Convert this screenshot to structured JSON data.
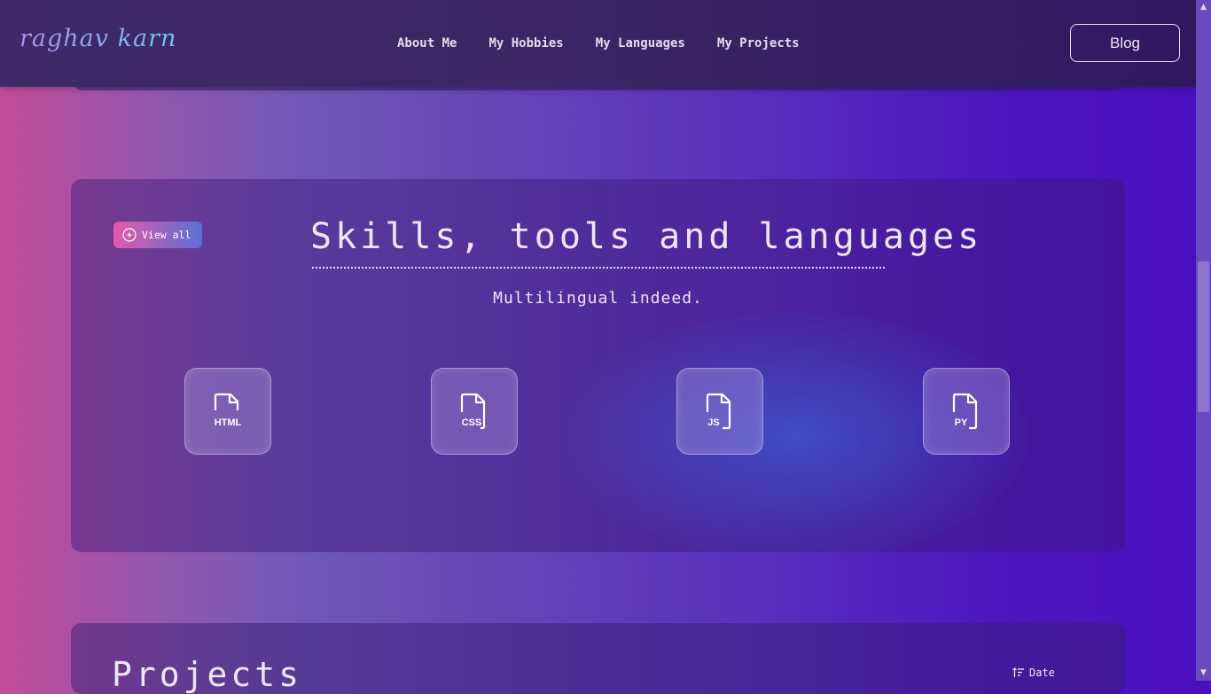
{
  "header": {
    "logo_text": "raghav karn",
    "nav": [
      "About Me",
      "My Hobbies",
      "My Languages",
      "My Projects"
    ],
    "blog_label": "Blog"
  },
  "skills": {
    "view_all_label": "View all",
    "title": "Skills, tools and languages",
    "subtitle": "Multilingual indeed.",
    "languages": [
      {
        "label": "HTML",
        "icon": "html-file-icon"
      },
      {
        "label": "CSS",
        "icon": "css-file-icon"
      },
      {
        "label": "JS",
        "icon": "js-file-icon"
      },
      {
        "label": "PY",
        "icon": "py-file-icon"
      }
    ]
  },
  "projects": {
    "title": "Projects",
    "sort_label": "Date"
  },
  "colors": {
    "accent_pink": "#e35aa8",
    "accent_blue": "#5b6fd6",
    "header_bg": "#3a2764"
  }
}
